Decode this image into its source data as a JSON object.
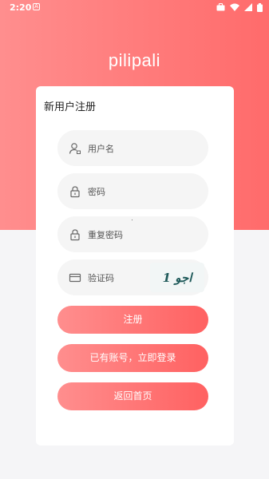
{
  "status_bar": {
    "time": "2:20",
    "notif_icon_letter": "A"
  },
  "app_title": "pilipali",
  "form": {
    "title": "新用户注册",
    "username": {
      "placeholder": "用户名",
      "icon": "user-icon"
    },
    "password": {
      "placeholder": "密码",
      "icon": "lock-icon"
    },
    "confirm_password": {
      "placeholder": "重复密码",
      "icon": "lock-icon"
    },
    "captcha": {
      "placeholder": "验证码",
      "icon": "card-icon",
      "image_text": "1 اجو"
    }
  },
  "buttons": {
    "register": "注册",
    "have_account": "已有账号，立即登录",
    "back_home": "返回首页"
  },
  "colors": {
    "accent_start": "#ff8e8e",
    "accent_end": "#ff6161",
    "background": "#f5f5f7"
  }
}
